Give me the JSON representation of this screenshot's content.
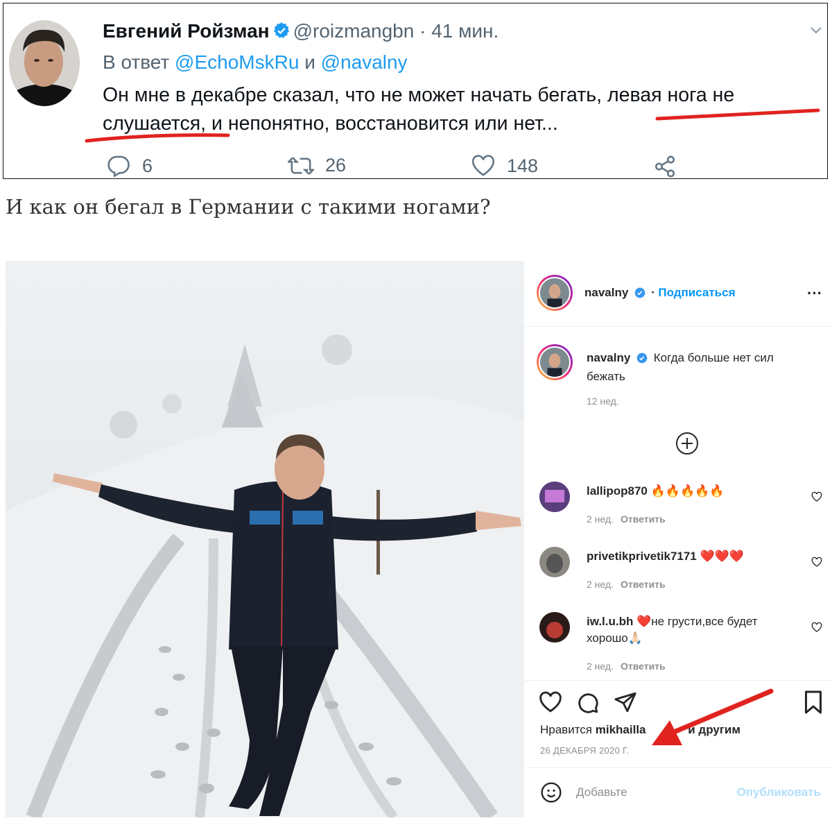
{
  "tweet": {
    "name": "Евгений Ройзман",
    "handle": "@roizmangbn",
    "time": "· 41 мин.",
    "reply_prefix": "В ответ",
    "reply_user1": "@EchoMskRu",
    "reply_and": "и",
    "reply_user2": "@navalny",
    "text_line1": "Он мне в декабре сказал, что не может начать бегать, левая нога не",
    "text_line2": "слушается, и непонятно, восстановится или нет...",
    "replies": "6",
    "retweets": "26",
    "likes": "148"
  },
  "caption": "И как он бегал в Германии с такими ногами?",
  "instagram": {
    "header_user": "navalny",
    "header_sep": "·",
    "follow": "Подписаться",
    "more": "···",
    "post_user": "navalny",
    "post_text": "Когда больше нет сил бежать",
    "post_age": "12 нед.",
    "comments": [
      {
        "user": "lallipop870",
        "text": "🔥🔥🔥🔥🔥",
        "age": "2 нед.",
        "reply": "Ответить"
      },
      {
        "user": "privetikprivetik7171",
        "text": "❤️❤️❤️",
        "age": "2 нед.",
        "reply": "Ответить"
      },
      {
        "user": "iw.l.u.bh",
        "text": "❤️не грусти,все будет хорошо🙏🏻",
        "age": "2 нед.",
        "reply": "Ответить"
      }
    ],
    "likes_prefix": "Нравится",
    "likes_user": "mikhailla",
    "likes_suffix": "и другим",
    "date": "26 ДЕКАБРЯ 2020 Г.",
    "comment_placeholder": "Добавьте",
    "publish": "Опубликовать"
  },
  "colors": {
    "twitter_blue": "#1d9bf0",
    "instagram_blue": "#0095f6",
    "annotation_red": "#e0231f"
  }
}
